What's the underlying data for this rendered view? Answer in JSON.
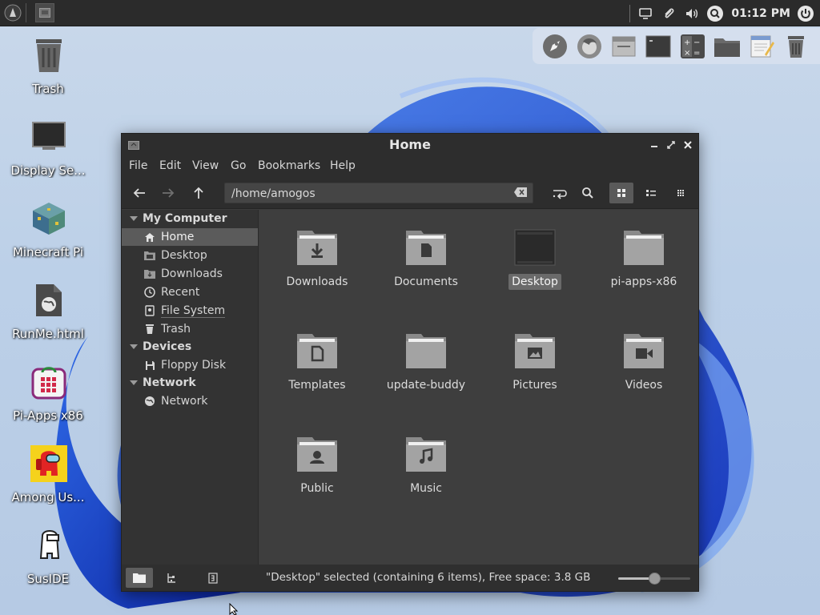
{
  "panel": {
    "clock": "01:12 PM"
  },
  "desktop_icons": [
    {
      "label": "Trash",
      "icon": "trash-icon"
    },
    {
      "label": "Display Se...",
      "icon": "monitor-icon"
    },
    {
      "label": "Minecraft Pi",
      "icon": "minecraft-block-icon"
    },
    {
      "label": "RunMe.html",
      "icon": "html-file-icon"
    },
    {
      "label": "Pi-Apps x86",
      "icon": "pi-apps-icon"
    },
    {
      "label": "Among Us...",
      "icon": "among-us-icon"
    },
    {
      "label": "SusIDE",
      "icon": "suside-icon"
    }
  ],
  "dock": [
    "launcher-rocket-icon",
    "firefox-icon",
    "window-minimize-icon",
    "terminal-icon",
    "calculator-icon",
    "folder-icon",
    "text-editor-icon",
    "trash-icon"
  ],
  "window": {
    "title": "Home",
    "menu": [
      "File",
      "Edit",
      "View",
      "Go",
      "Bookmarks",
      "Help"
    ],
    "location": "/home/amogos",
    "sidebar": {
      "sections": [
        {
          "heading": "My Computer",
          "items": [
            "Home",
            "Desktop",
            "Downloads",
            "Recent",
            "File System",
            "Trash"
          ]
        },
        {
          "heading": "Devices",
          "items": [
            "Floppy Disk"
          ]
        },
        {
          "heading": "Network",
          "items": [
            "Network"
          ]
        }
      ],
      "selected": "Home"
    },
    "files": [
      {
        "name": "Downloads",
        "icon": "download-folder-icon"
      },
      {
        "name": "Documents",
        "icon": "documents-folder-icon"
      },
      {
        "name": "Desktop",
        "icon": "desktop-folder-icon",
        "selected": true
      },
      {
        "name": "pi-apps-x86",
        "icon": "folder-icon"
      },
      {
        "name": "Templates",
        "icon": "templates-folder-icon"
      },
      {
        "name": "update-buddy",
        "icon": "folder-icon"
      },
      {
        "name": "Pictures",
        "icon": "pictures-folder-icon"
      },
      {
        "name": "Videos",
        "icon": "videos-folder-icon"
      },
      {
        "name": "Public",
        "icon": "public-folder-icon"
      },
      {
        "name": "Music",
        "icon": "music-folder-icon"
      }
    ],
    "status": "\"Desktop\" selected (containing 6 items), Free space: 3.8 GB",
    "zoom_level": 0.5
  },
  "colors": {
    "wallpaper_blue": "#1f4fd8",
    "window_bg": "#3c3c3c",
    "titlebar_bg": "#2d2d2d"
  }
}
